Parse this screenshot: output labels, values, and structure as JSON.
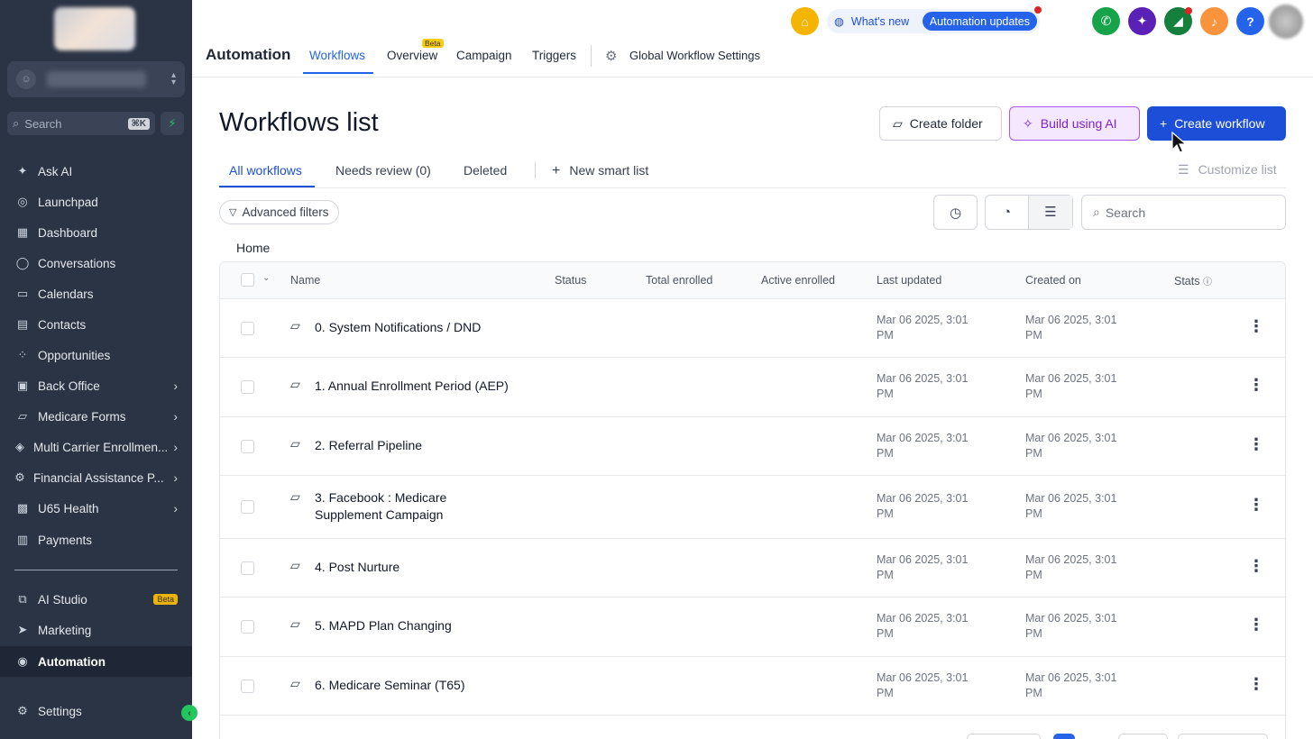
{
  "sidebar": {
    "search_placeholder": "Search",
    "search_shortcut": "⌘K",
    "items": [
      {
        "label": "Ask AI",
        "icon": "sparkle-icon"
      },
      {
        "label": "Launchpad",
        "icon": "rocket-icon"
      },
      {
        "label": "Dashboard",
        "icon": "dashboard-grid-icon"
      },
      {
        "label": "Conversations",
        "icon": "chat-bubble-icon"
      },
      {
        "label": "Calendars",
        "icon": "calendar-icon"
      },
      {
        "label": "Contacts",
        "icon": "contacts-book-icon"
      },
      {
        "label": "Opportunities",
        "icon": "opportunities-icon"
      },
      {
        "label": "Back Office",
        "icon": "id-card-icon"
      },
      {
        "label": "Medicare Forms",
        "icon": "folder-icon"
      },
      {
        "label": "Multi Carrier Enrollmen...",
        "icon": "layers-icon"
      },
      {
        "label": "Financial Assistance P...",
        "icon": "gear-icon"
      },
      {
        "label": "U65 Health",
        "icon": "medical-bag-icon"
      },
      {
        "label": "Payments",
        "icon": "receipt-icon"
      }
    ],
    "bottom_items": [
      {
        "label": "AI Studio",
        "badge": "Beta"
      },
      {
        "label": "Marketing"
      },
      {
        "label": "Automation"
      },
      {
        "label": "Settings"
      }
    ]
  },
  "header": {
    "brand": "Automation",
    "tabs": [
      "Workflows",
      "Overview",
      "Campaign",
      "Triggers"
    ],
    "overview_badge": "Beta",
    "global_settings": "Global Workflow Settings",
    "whats_new": "What's new",
    "automation_updates": "Automation updates",
    "help_glyph": "?"
  },
  "main": {
    "title": "Workflows list",
    "create_folder": "Create folder",
    "build_ai": "Build using AI",
    "create_workflow": "Create workflow",
    "subtabs": [
      "All workflows",
      "Needs review (0)",
      "Deleted"
    ],
    "new_smart_list": "New smart list",
    "customize_list": "Customize list",
    "advanced_filters": "Advanced filters",
    "search_placeholder": "Search",
    "breadcrumb": "Home"
  },
  "table": {
    "columns": [
      "Name",
      "Status",
      "Total enrolled",
      "Active enrolled",
      "Last updated",
      "Created on",
      "Stats"
    ],
    "rows": [
      {
        "name": "0. System Notifications / DND",
        "last_updated": "Mar 06 2025, 3:01 PM",
        "created_on": "Mar 06 2025, 3:01 PM"
      },
      {
        "name": "1. Annual Enrollment Period (AEP)",
        "last_updated": "Mar 06 2025, 3:01 PM",
        "created_on": "Mar 06 2025, 3:01 PM"
      },
      {
        "name": "2. Referral Pipeline",
        "last_updated": "Mar 06 2025, 3:01 PM",
        "created_on": "Mar 06 2025, 3:01 PM"
      },
      {
        "name": "3. Facebook : Medicare Supplement Campaign",
        "last_updated": "Mar 06 2025, 3:01 PM",
        "created_on": "Mar 06 2025, 3:01 PM"
      },
      {
        "name": "4. Post Nurture",
        "last_updated": "Mar 06 2025, 3:01 PM",
        "created_on": "Mar 06 2025, 3:01 PM"
      },
      {
        "name": "5. MAPD Plan Changing",
        "last_updated": "Mar 06 2025, 3:01 PM",
        "created_on": "Mar 06 2025, 3:01 PM"
      },
      {
        "name": "6. Medicare Seminar (T65)",
        "last_updated": "Mar 06 2025, 3:01 PM",
        "created_on": "Mar 06 2025, 3:01 PM"
      }
    ]
  },
  "colors": {
    "sidebar_bg": "#2b3445",
    "accent": "#1d4ed8",
    "ai_purple": "#7e22ce",
    "beta_yellow": "#facc15"
  }
}
